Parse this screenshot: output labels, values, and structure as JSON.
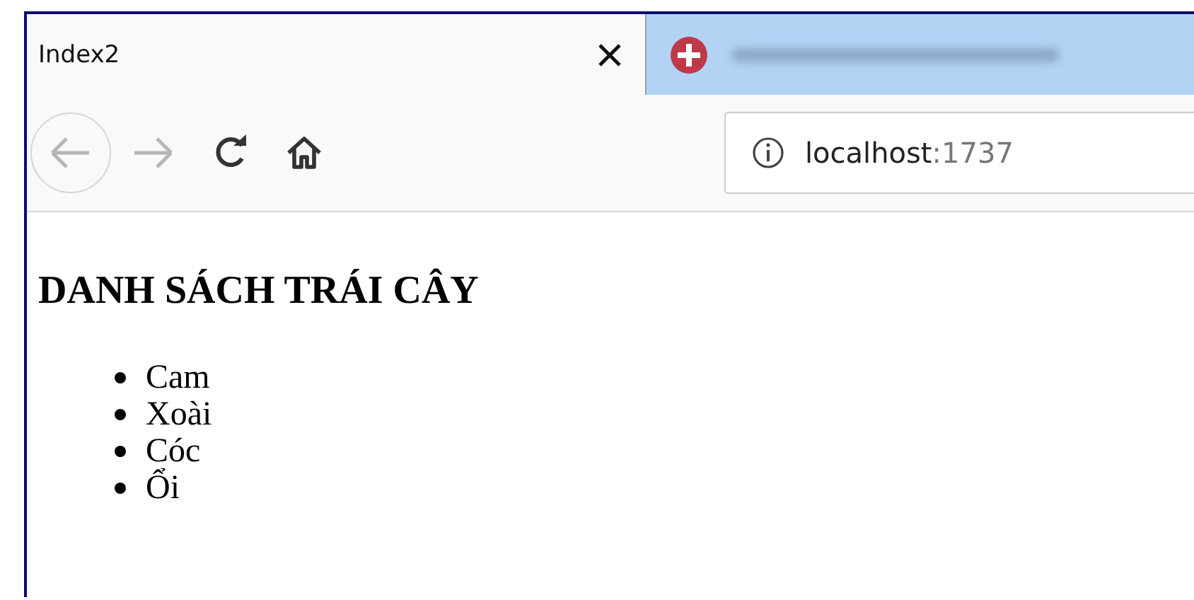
{
  "tabs": [
    {
      "kind": "page",
      "title": "Index2",
      "selected": true
    },
    {
      "kind": "blurred",
      "selected": false
    }
  ],
  "toolbar": {
    "back_disabled": true,
    "forward_disabled": true
  },
  "url": {
    "host": "localhost",
    "port": ":1737"
  },
  "page": {
    "heading": "DANH SÁCH TRÁI CÂY",
    "items": [
      "Cam",
      "Xoài",
      "Cóc",
      "Ổi"
    ]
  }
}
